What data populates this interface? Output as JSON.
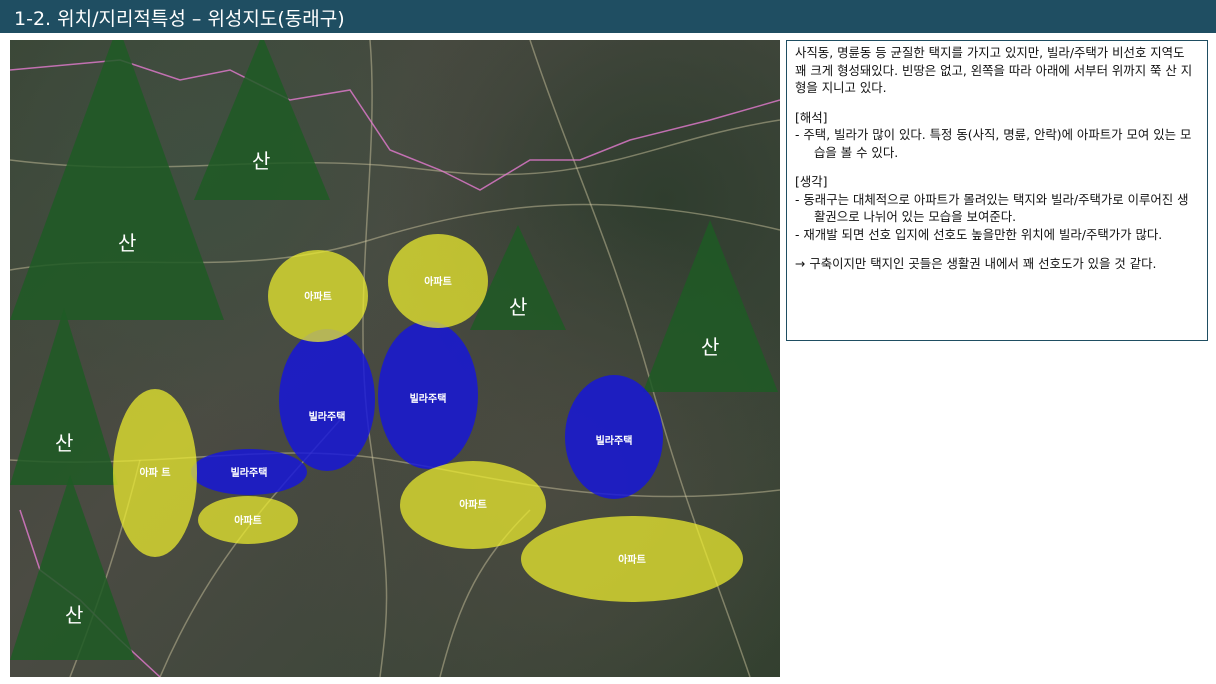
{
  "header": {
    "title": "1-2. 위치/지리적특성 – 위성지도(동래구)"
  },
  "map": {
    "mountain_label": "산",
    "apartment_label": "아파트",
    "apartment_label_alt": "아파 트",
    "villa_label": "빌라주택",
    "colors": {
      "mountain": "#1e5a25",
      "apartment": "#f0f02e",
      "villa": "#1515dd"
    }
  },
  "notes": {
    "intro": "사직동, 명륜동 등 균질한 택지를 가지고 있지만, 빌라/주택가 비선호 지역도 꽤 크게 형성돼있다. 빈땅은 없고, 왼쪽을 따라 아래에 서부터 위까지 쭉 산 지형을 지니고 있다.",
    "interpretation_heading": "[해석]",
    "interpretation_items": [
      "-   주택, 빌라가 많이 있다. 특정 동(사직, 명륜, 안락)에 아파트가 모여 있는 모습을 볼 수 있다."
    ],
    "thoughts_heading": "[생각]",
    "thoughts_items": [
      "-   동래구는 대체적으로 아파트가 몰려있는 택지와 빌라/주택가로 이루어진 생활권으로 나뉘어 있는 모습을 보여준다.",
      "-   재개발 되면 선호 입지에 선호도 높을만한 위치에 빌라/주택가가 많다."
    ],
    "conclusion": "→ 구축이지만 택지인 곳들은 생활권 내에서 꽤 선호도가 있을 것 같다."
  }
}
